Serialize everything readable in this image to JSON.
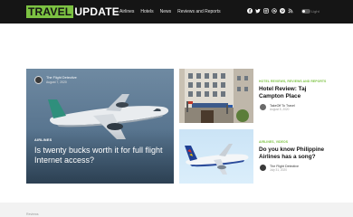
{
  "brand": {
    "part1": "TRAVEL",
    "part2": "UPDATE",
    "green": "#7cc242",
    "dark": "#151515"
  },
  "nav": [
    {
      "label": "Airlines"
    },
    {
      "label": "Hotels"
    },
    {
      "label": "News"
    },
    {
      "label": "Reviews and Reports"
    }
  ],
  "social": [
    "facebook-icon",
    "twitter-icon",
    "instagram-icon",
    "email-icon",
    "pinterest-icon",
    "rss-icon"
  ],
  "mode_toggle": {
    "label": "Light"
  },
  "hero": {
    "author": "The Flight Detective",
    "date": "August 7, 2020",
    "category": "AIRLINES",
    "title": "Is twenty bucks worth it for full flight Internet access?"
  },
  "cards": [
    {
      "category": "HOTEL REVIEWS, REVIEWS AND REPORTS",
      "title": "Hotel Review: Taj Campton Place",
      "author": "TakeOff To Travel",
      "date": "August 5, 2020"
    },
    {
      "category": "AIRLINES, VIDEOS",
      "title": "Do you know Philippine Airlines has a song?",
      "author": "The Flight Detective",
      "date": "July 31, 2020"
    }
  ],
  "footer": {
    "label": "Reviews"
  }
}
